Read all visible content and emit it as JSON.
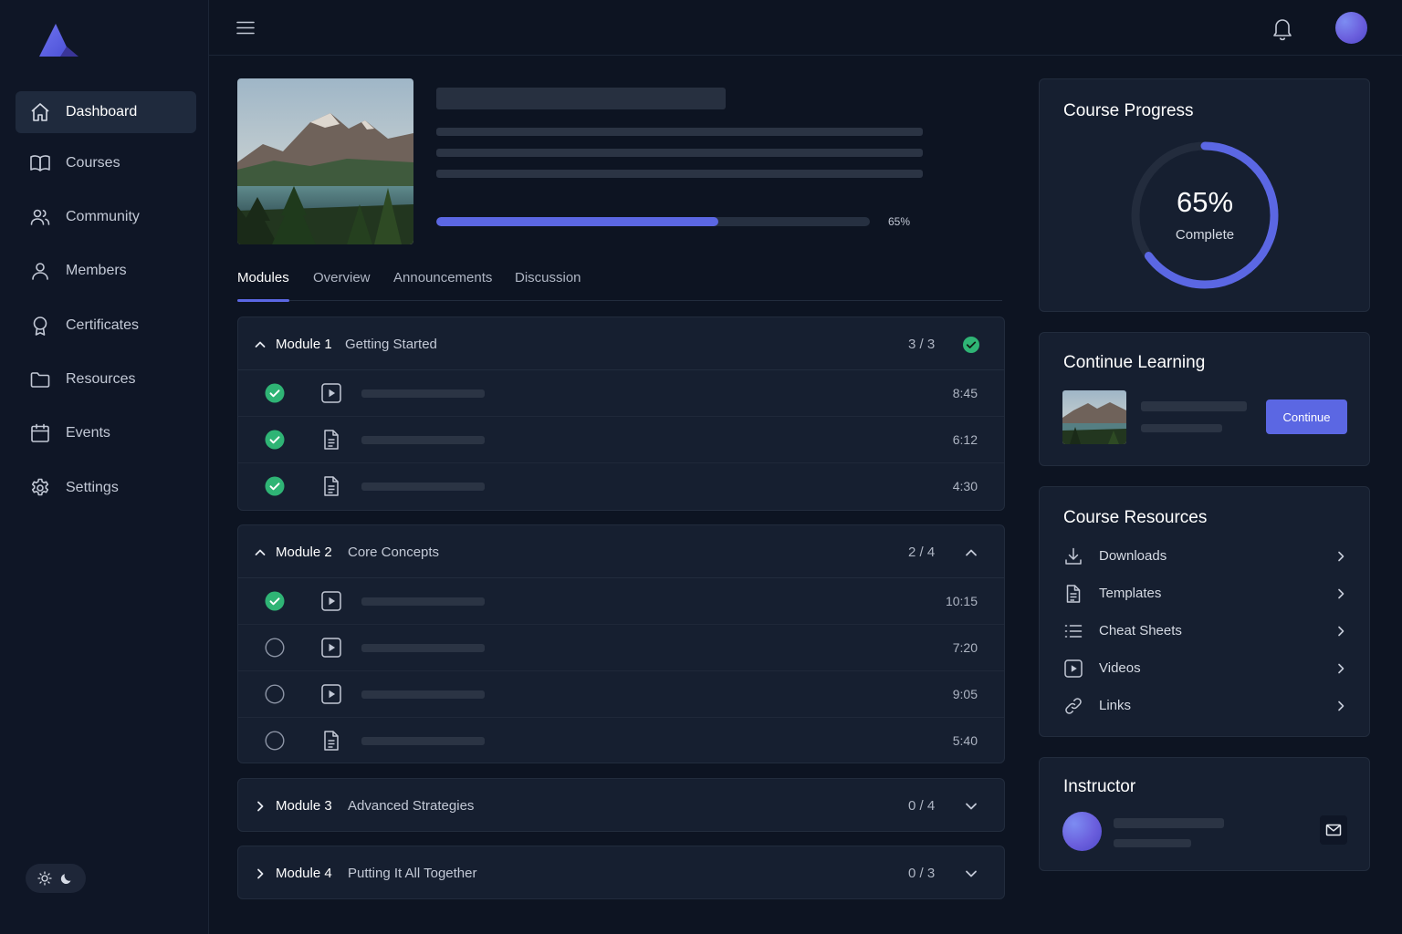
{
  "sidebar": {
    "items": [
      {
        "label": "Dashboard",
        "icon": "home-icon"
      },
      {
        "label": "Courses",
        "icon": "book-icon"
      },
      {
        "label": "Community",
        "icon": "users-icon"
      },
      {
        "label": "Members",
        "icon": "user-icon"
      },
      {
        "label": "Certificates",
        "icon": "award-icon"
      },
      {
        "label": "Resources",
        "icon": "folder-icon"
      },
      {
        "label": "Events",
        "icon": "calendar-icon"
      },
      {
        "label": "Settings",
        "icon": "gear-icon"
      }
    ],
    "active": "Dashboard"
  },
  "course": {
    "progress_percent": 65,
    "progress_label": "65%"
  },
  "tabs": [
    {
      "label": "Modules",
      "active": true
    },
    {
      "label": "Overview",
      "active": false
    },
    {
      "label": "Announcements",
      "active": false
    },
    {
      "label": "Discussion",
      "active": false
    }
  ],
  "modules": [
    {
      "number": "Module 1",
      "title": "Getting Started",
      "count": "3 / 3",
      "expanded": true,
      "complete": true,
      "lessons": [
        {
          "type": "video",
          "done": true,
          "duration": "8:45"
        },
        {
          "type": "document",
          "done": true,
          "duration": "6:12"
        },
        {
          "type": "document",
          "done": true,
          "duration": "4:30"
        }
      ]
    },
    {
      "number": "Module 2",
      "title": "Core Concepts",
      "count": "2 / 4",
      "expanded": true,
      "complete": false,
      "lessons": [
        {
          "type": "video",
          "done": true,
          "duration": "10:15"
        },
        {
          "type": "video",
          "done": false,
          "duration": "7:20"
        },
        {
          "type": "video",
          "done": false,
          "duration": "9:05"
        },
        {
          "type": "document",
          "done": false,
          "duration": "5:40"
        }
      ]
    },
    {
      "number": "Module 3",
      "title": "Advanced Strategies",
      "count": "0 / 4",
      "expanded": false,
      "complete": false
    },
    {
      "number": "Module 4",
      "title": "Putting It All Together",
      "count": "0 / 3",
      "expanded": false,
      "complete": false
    }
  ],
  "progress_card": {
    "title": "Course Progress",
    "percent": 65,
    "percent_label": "65%",
    "sub_label": "Complete"
  },
  "continue_card": {
    "title": "Continue Learning",
    "button_label": "Continue"
  },
  "resources_card": {
    "title": "Course Resources",
    "items": [
      {
        "label": "Downloads",
        "icon": "download-icon"
      },
      {
        "label": "Templates",
        "icon": "document-icon"
      },
      {
        "label": "Cheat Sheets",
        "icon": "list-icon"
      },
      {
        "label": "Videos",
        "icon": "video-icon"
      },
      {
        "label": "Links",
        "icon": "link-icon"
      }
    ]
  },
  "instructor_card": {
    "title": "Instructor"
  },
  "colors": {
    "accent": "#5b67e3",
    "success": "#2fb475",
    "background": "#0d1422",
    "card": "#161f30"
  }
}
